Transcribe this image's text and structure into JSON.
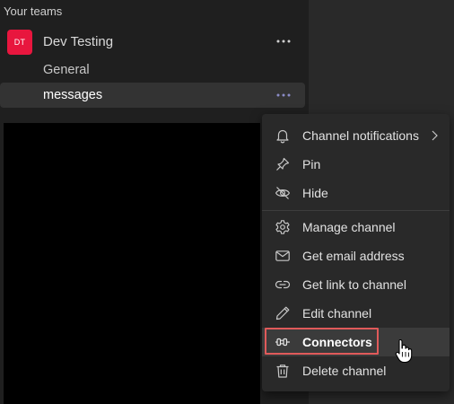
{
  "sidebar": {
    "section_header": "Your teams",
    "team": {
      "avatar_initials": "DT",
      "avatar_color": "#e8163e",
      "name": "Dev Testing",
      "more_icon": "more-horizontal-icon"
    },
    "channels": [
      {
        "label": "General",
        "active": false
      },
      {
        "label": "messages",
        "active": true,
        "more_icon": "more-horizontal-icon"
      }
    ]
  },
  "context_menu": {
    "items": [
      {
        "label": "Channel notifications",
        "icon": "bell-icon",
        "has_submenu": true
      },
      {
        "label": "Pin",
        "icon": "pin-icon"
      },
      {
        "label": "Hide",
        "icon": "eye-off-icon"
      },
      {
        "label": "Manage channel",
        "icon": "gear-icon"
      },
      {
        "label": "Get email address",
        "icon": "mail-icon"
      },
      {
        "label": "Get link to channel",
        "icon": "link-icon"
      },
      {
        "label": "Edit channel",
        "icon": "pencil-icon"
      },
      {
        "label": "Connectors",
        "icon": "connector-plug-icon",
        "hovered": true,
        "highlighted": true
      },
      {
        "label": "Delete channel",
        "icon": "trash-icon"
      }
    ],
    "highlight_color": "#e05a5a",
    "accent_dots_color": "#8b8cc7"
  }
}
